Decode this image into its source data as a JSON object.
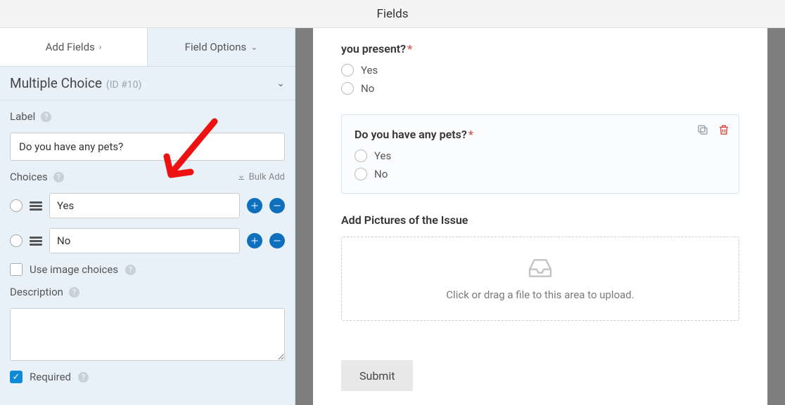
{
  "header": {
    "title": "Fields"
  },
  "sidebar": {
    "tabs": {
      "add_fields": "Add Fields",
      "field_options": "Field Options"
    },
    "field_type": "Multiple Choice",
    "field_id": "(ID #10)",
    "label_caption": "Label",
    "label_value": "Do you have any pets?",
    "choices_caption": "Choices",
    "bulk_add": "Bulk Add",
    "choices": [
      {
        "value": "Yes"
      },
      {
        "value": "No"
      }
    ],
    "image_choices": "Use image choices",
    "description_caption": "Description",
    "description_value": "",
    "required_caption": "Required"
  },
  "preview": {
    "q1": {
      "label": "you present?",
      "opts": [
        "Yes",
        "No"
      ]
    },
    "q2": {
      "label": "Do you have any pets?",
      "opts": [
        "Yes",
        "No"
      ]
    },
    "upload_label": "Add Pictures of the Issue",
    "dropzone_text": "Click or drag a file to this area to upload.",
    "submit": "Submit"
  }
}
